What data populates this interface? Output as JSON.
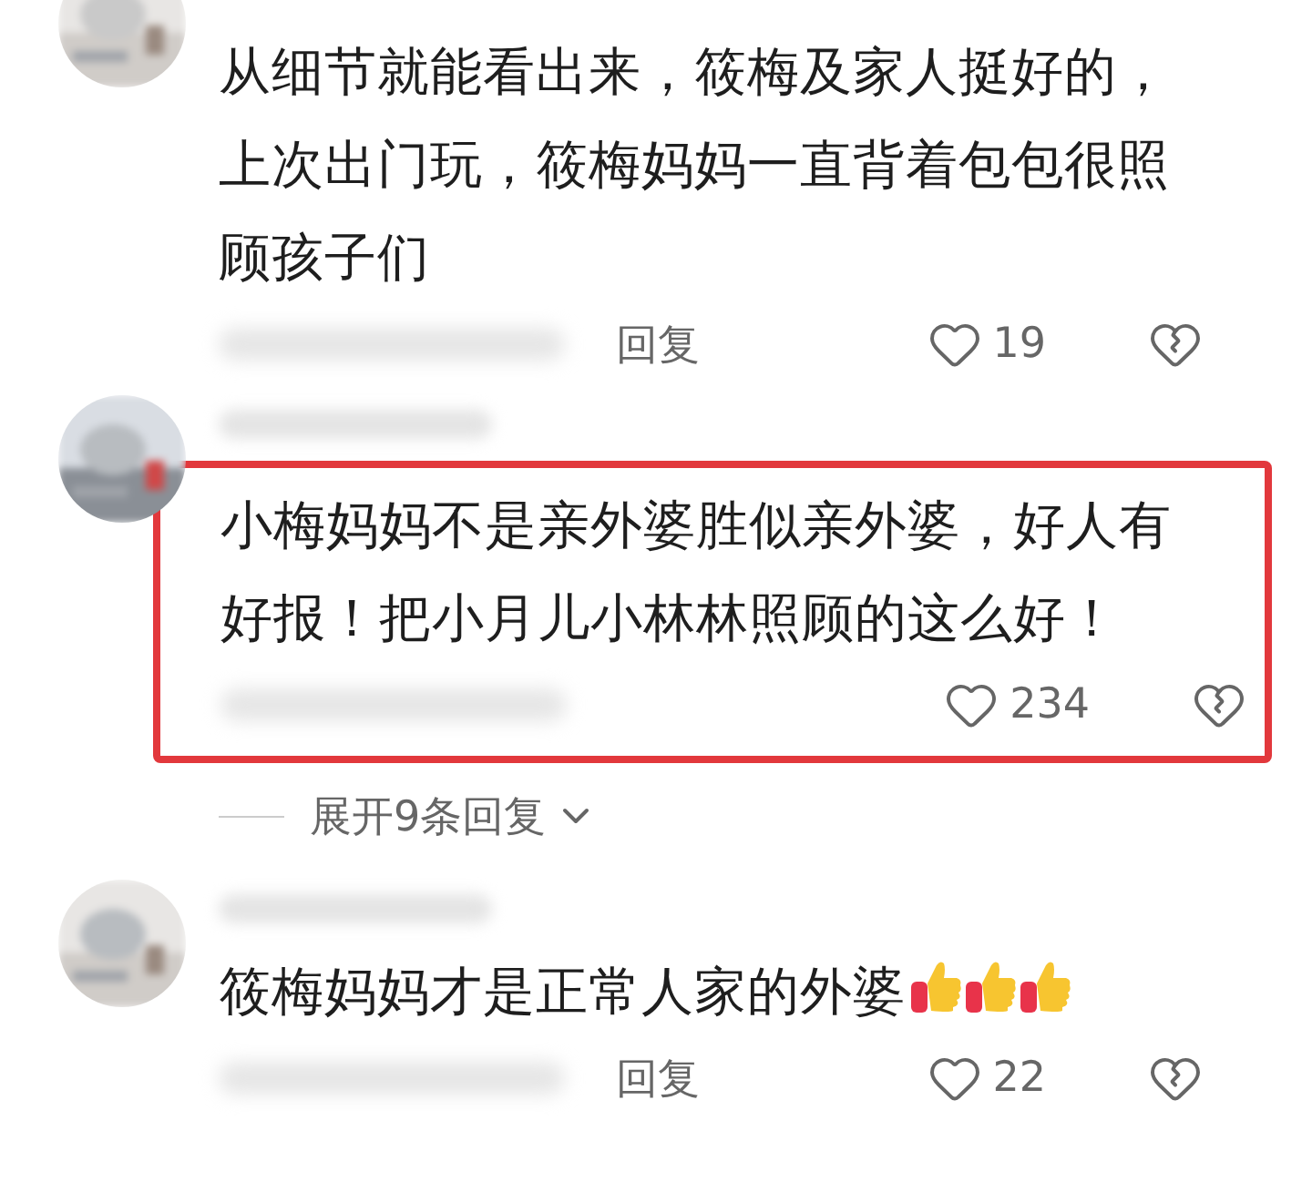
{
  "comments": [
    {
      "text": "从细节就能看出来，筱梅及家人挺好的，上次出门玩，筱梅妈妈一直背着包包很照顾孩子们",
      "highlighted": false,
      "reply_label": "回复",
      "likes": "19"
    },
    {
      "text": "小梅妈妈不是亲外婆胜似亲外婆，好人有好报！把小月儿小林林照顾的这么好！",
      "highlighted": true,
      "likes": "234",
      "expand_label": "展开9条回复"
    },
    {
      "text": "筱梅妈妈才是正常人家的外婆",
      "highlighted": false,
      "reply_label": "回复",
      "likes": "22",
      "emojis": [
        {
          "kind": "thumbs_up"
        },
        {
          "kind": "thumbs_up"
        },
        {
          "kind": "thumbs_up"
        }
      ]
    }
  ]
}
